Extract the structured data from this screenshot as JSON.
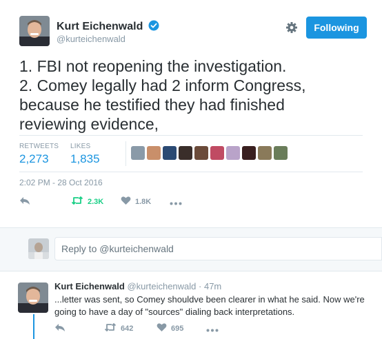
{
  "tweet": {
    "author_name": "Kurt Eichenwald",
    "author_handle": "@kurteichenwald",
    "follow_label": "Following",
    "text_lines": [
      "1. FBI not reopening the investigation.",
      "2. Comey legally had 2 inform Congress,",
      "because he testified they had finished",
      "reviewing evidence,"
    ],
    "stats": {
      "retweets_label": "RETWEETS",
      "retweets_value": "2,273",
      "likes_label": "LIKES",
      "likes_value": "1,835"
    },
    "liker_faces": [
      "#8a9aa8",
      "#c98f6a",
      "#2b4a73",
      "#3a2e2a",
      "#6b4b3a",
      "#c04b63",
      "#b9a3c9",
      "#3a2020",
      "#8a7a5a",
      "#6a7d5a"
    ],
    "timestamp": "2:02 PM - 28 Oct 2016",
    "actions": {
      "retweet_count": "2.3K",
      "like_count": "1.8K"
    }
  },
  "reply": {
    "placeholder": "Reply to @kurteichenwald"
  },
  "sub_tweet": {
    "author_name": "Kurt Eichenwald",
    "author_handle": "@kurteichenwald",
    "time": "· 47m",
    "text": "...letter was sent, so Comey shouldve been clearer in what he said. Now we're going to have a day of \"sources\" dialing back interpretations.",
    "retweet_count": "642",
    "like_count": "695"
  },
  "colors": {
    "accent": "#1b95e0",
    "retweet_green": "#19cf86",
    "muted": "#8899a6"
  },
  "icons": [
    "verified-badge-icon",
    "gear-icon",
    "reply-icon",
    "retweet-icon",
    "heart-icon",
    "more-icon"
  ]
}
